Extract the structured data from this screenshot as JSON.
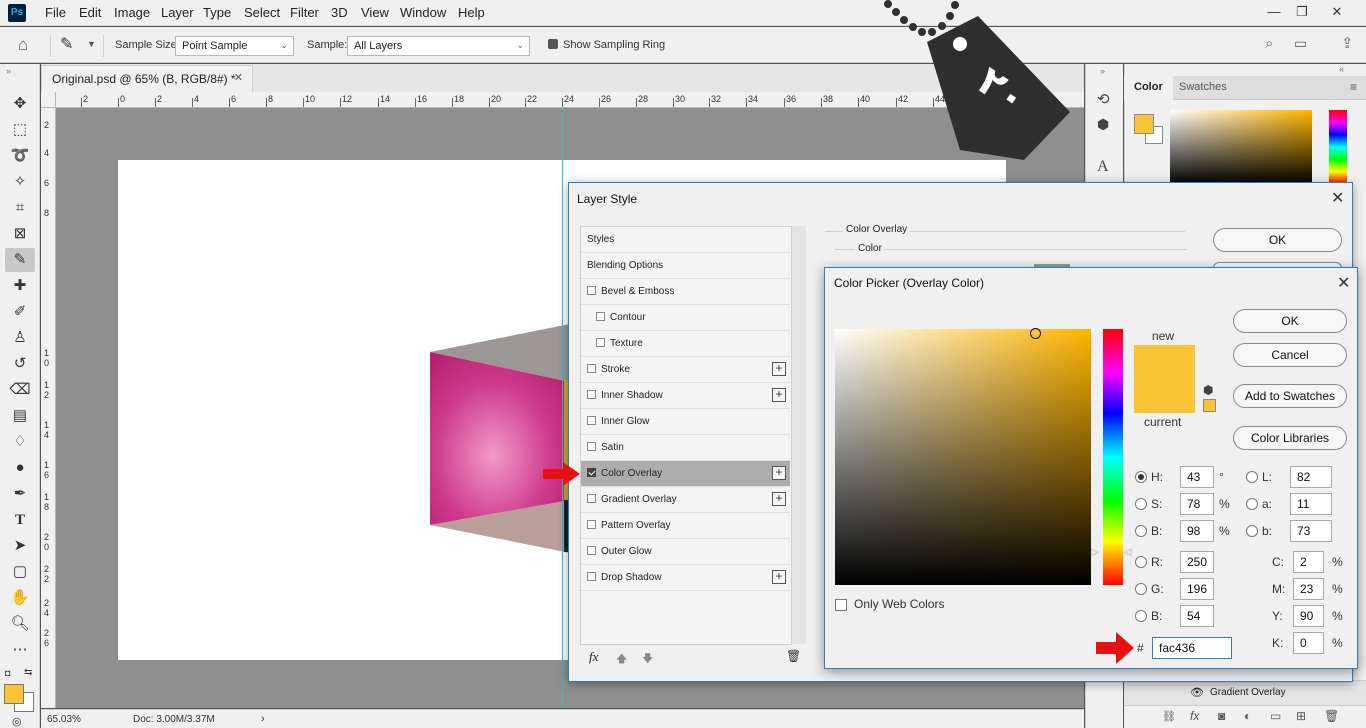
{
  "app": {
    "logo": "Ps"
  },
  "menu": [
    "File",
    "Edit",
    "Image",
    "Layer",
    "Type",
    "Select",
    "Filter",
    "3D",
    "View",
    "Window",
    "Help"
  ],
  "window_controls": {
    "minimize": "—",
    "restore": "❐",
    "close": "✕"
  },
  "options_bar": {
    "sample_size_label": "Sample Size:",
    "sample_size_value": "Point Sample",
    "sample_label": "Sample:",
    "sample_value": "All Layers",
    "show_ring_label": "Show Sampling Ring"
  },
  "document": {
    "tab_title": "Original.psd @ 65% (B, RGB/8#) *",
    "ruler_h": [
      "2",
      "0",
      "2",
      "4",
      "6",
      "8",
      "10",
      "12",
      "14",
      "16",
      "18",
      "20",
      "22",
      "24",
      "26",
      "28",
      "30",
      "32",
      "34",
      "36",
      "38",
      "40",
      "42",
      "44"
    ],
    "ruler_v": [
      "2",
      "4",
      "6",
      "8",
      "1\n0",
      "1\n2",
      "1\n4",
      "1\n6",
      "1\n8",
      "2\n0",
      "2\n2",
      "2\n4",
      "2\n6"
    ],
    "zoom": "65.03%",
    "doc_size": "Doc: 3.00M/3.37M"
  },
  "color_panel": {
    "tabs": [
      "Color",
      "Swatches"
    ],
    "foreground": "#fac436",
    "background": "#ffffff"
  },
  "layers_panel": {
    "visible_row": "Gradient Overlay"
  },
  "layer_style": {
    "title": "Layer Style",
    "section_title": "Color Overlay",
    "subsection": "Color",
    "items": [
      {
        "label": "Styles",
        "checkbox": false,
        "checked": false,
        "plus": false,
        "indent": false
      },
      {
        "label": "Blending Options",
        "checkbox": false,
        "checked": false,
        "plus": false,
        "indent": false
      },
      {
        "label": "Bevel & Emboss",
        "checkbox": true,
        "checked": false,
        "plus": false,
        "indent": false
      },
      {
        "label": "Contour",
        "checkbox": true,
        "checked": false,
        "plus": false,
        "indent": true
      },
      {
        "label": "Texture",
        "checkbox": true,
        "checked": false,
        "plus": false,
        "indent": true
      },
      {
        "label": "Stroke",
        "checkbox": true,
        "checked": false,
        "plus": true,
        "indent": false
      },
      {
        "label": "Inner Shadow",
        "checkbox": true,
        "checked": false,
        "plus": true,
        "indent": false
      },
      {
        "label": "Inner Glow",
        "checkbox": true,
        "checked": false,
        "plus": false,
        "indent": false
      },
      {
        "label": "Satin",
        "checkbox": true,
        "checked": false,
        "plus": false,
        "indent": false
      },
      {
        "label": "Color Overlay",
        "checkbox": true,
        "checked": true,
        "plus": true,
        "indent": false,
        "selected": true
      },
      {
        "label": "Gradient Overlay",
        "checkbox": true,
        "checked": false,
        "plus": true,
        "indent": false
      },
      {
        "label": "Pattern Overlay",
        "checkbox": true,
        "checked": false,
        "plus": false,
        "indent": false
      },
      {
        "label": "Outer Glow",
        "checkbox": true,
        "checked": false,
        "plus": false,
        "indent": false
      },
      {
        "label": "Drop Shadow",
        "checkbox": true,
        "checked": false,
        "plus": true,
        "indent": false
      }
    ],
    "ok_label": "OK",
    "fx_label": "fx"
  },
  "color_picker": {
    "title": "Color Picker (Overlay Color)",
    "new_label": "new",
    "current_label": "current",
    "new_color": "#fac436",
    "current_color": "#fac436",
    "buttons": {
      "ok": "OK",
      "cancel": "Cancel",
      "add_to_swatches": "Add to Swatches",
      "color_libraries": "Color Libraries"
    },
    "only_web_colors": "Only Web Colors",
    "hsb": [
      {
        "label": "H:",
        "value": "43",
        "unit": "°"
      },
      {
        "label": "S:",
        "value": "78",
        "unit": "%"
      },
      {
        "label": "B:",
        "value": "98",
        "unit": "%"
      }
    ],
    "rgb": [
      {
        "label": "R:",
        "value": "250"
      },
      {
        "label": "G:",
        "value": "196"
      },
      {
        "label": "B:",
        "value": "54"
      }
    ],
    "lab": [
      {
        "label": "L:",
        "value": "82"
      },
      {
        "label": "a:",
        "value": "11"
      },
      {
        "label": "b:",
        "value": "73"
      }
    ],
    "cmyk": [
      {
        "label": "C:",
        "value": "2",
        "unit": "%"
      },
      {
        "label": "M:",
        "value": "23",
        "unit": "%"
      },
      {
        "label": "Y:",
        "value": "90",
        "unit": "%"
      },
      {
        "label": "K:",
        "value": "0",
        "unit": "%"
      }
    ],
    "hex_label": "#",
    "hex_value": "fac436"
  },
  "tag": {
    "text": "۲۰"
  }
}
